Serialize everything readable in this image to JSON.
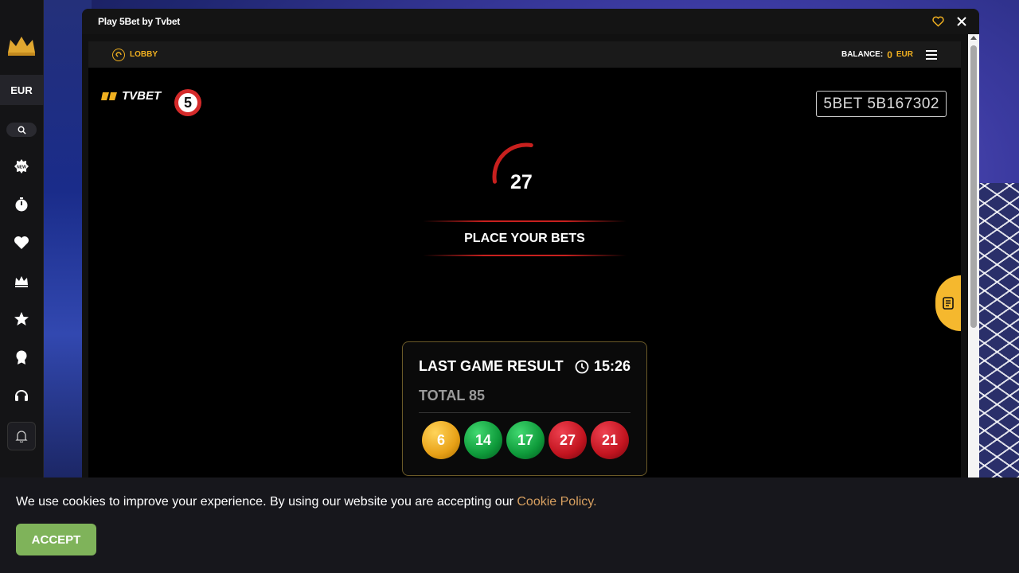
{
  "sidebar": {
    "currency": "EUR"
  },
  "window": {
    "title": "Play 5Bet by Tvbet"
  },
  "game": {
    "lobby_label": "LOBBY",
    "balance_label": "BALANCE:",
    "balance_value": "0",
    "balance_currency": "EUR",
    "brand": "TVBET",
    "five_logo": "5",
    "game_id": "5BET  5B167302",
    "timer_value": "27",
    "timer_progress": 0.3,
    "place_bets": "PLACE YOUR BETS"
  },
  "result": {
    "title": "LAST GAME RESULT",
    "time": "15:26",
    "total": "TOTAL 85",
    "balls": [
      {
        "value": "6",
        "color": "yellow"
      },
      {
        "value": "14",
        "color": "green"
      },
      {
        "value": "17",
        "color": "green"
      },
      {
        "value": "27",
        "color": "red"
      },
      {
        "value": "21",
        "color": "red"
      }
    ]
  },
  "cookie": {
    "text": "We use cookies to improve your experience. By using our website you are accepting our ",
    "link": "Cookie Policy.",
    "accept_label": "ACCEPT"
  },
  "colors": {
    "accent": "#f0b020",
    "accept": "#7fb35a",
    "timer": "#c8201e"
  }
}
